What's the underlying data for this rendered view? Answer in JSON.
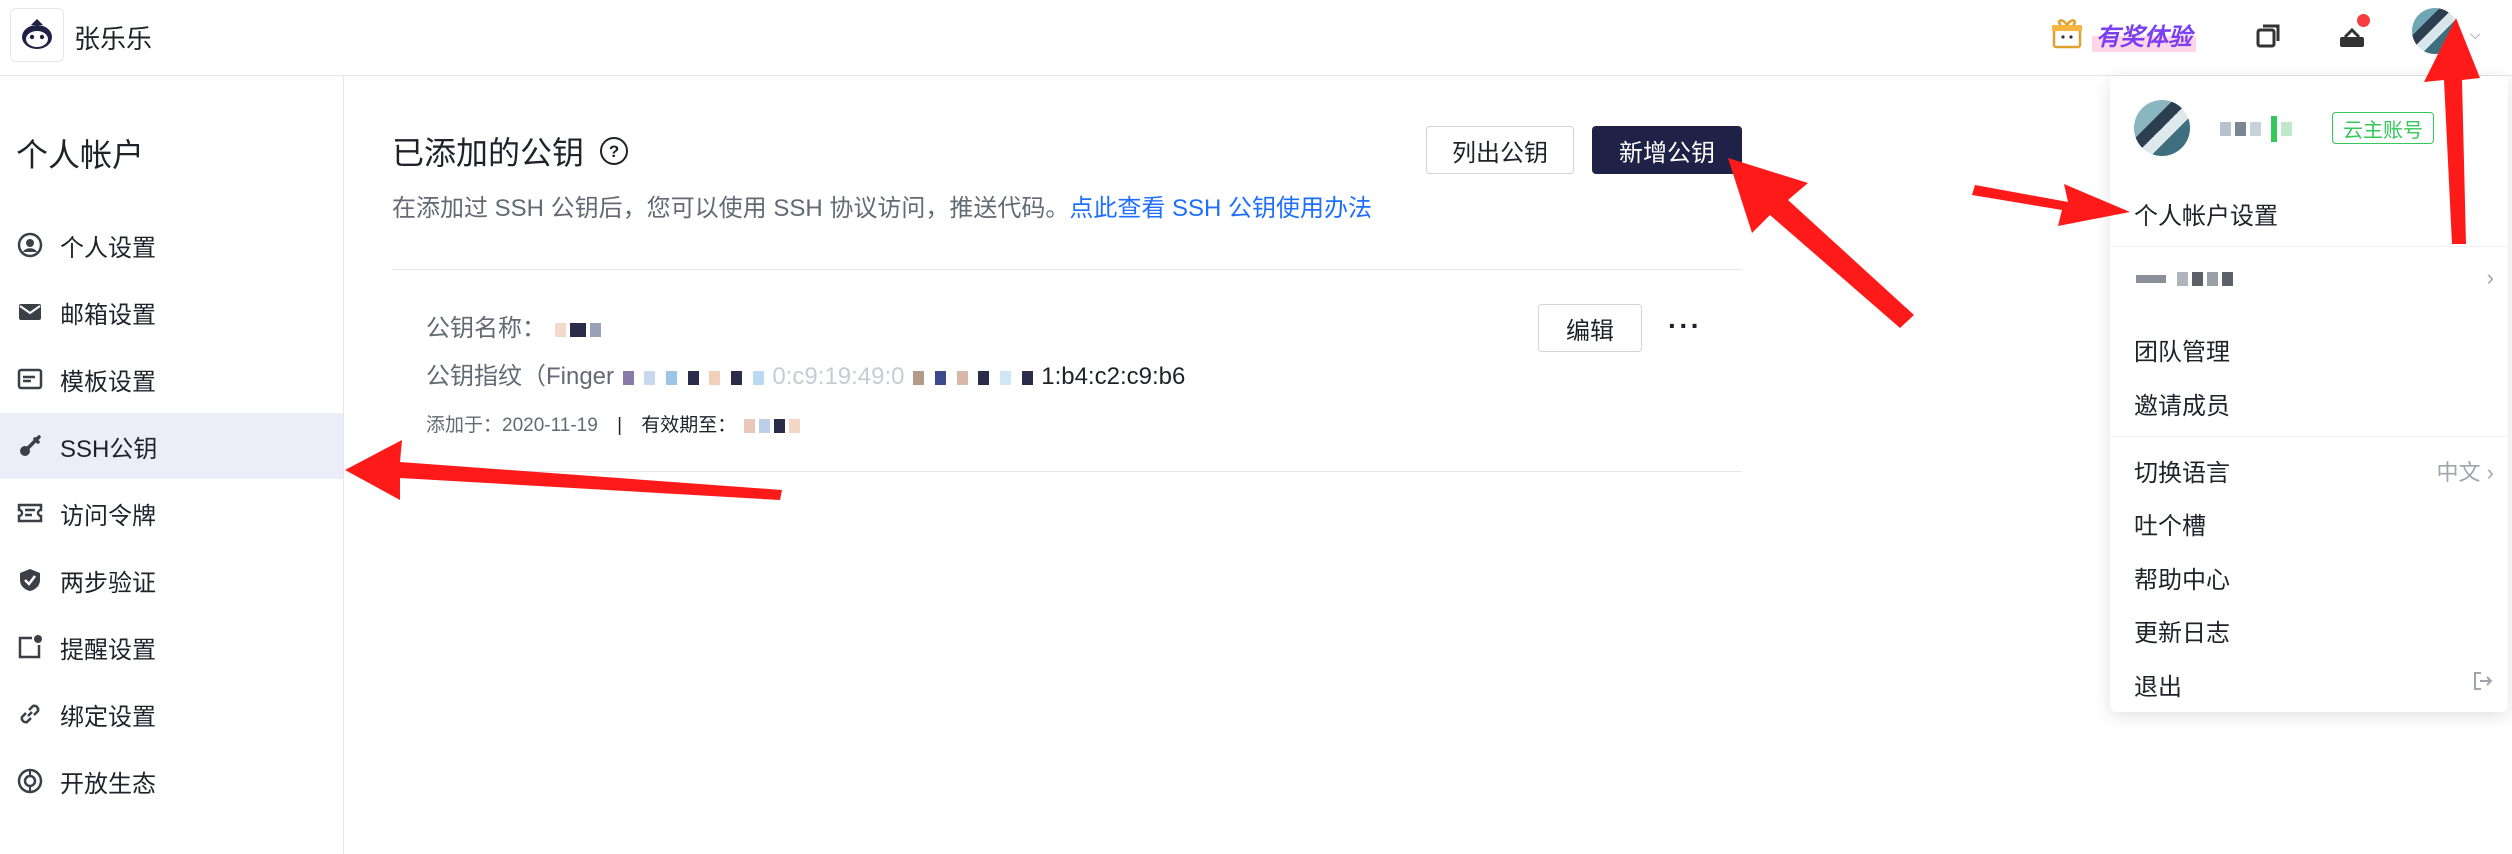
{
  "header": {
    "username": "张乐乐",
    "reward_label": "有奖体验"
  },
  "sidebar": {
    "title": "个人帐户",
    "items": [
      {
        "label": "个人设置",
        "icon": "user-circle-icon"
      },
      {
        "label": "邮箱设置",
        "icon": "mail-icon"
      },
      {
        "label": "模板设置",
        "icon": "template-icon"
      },
      {
        "label": "SSH公钥",
        "icon": "key-icon"
      },
      {
        "label": "访问令牌",
        "icon": "ticket-icon"
      },
      {
        "label": "两步验证",
        "icon": "shield-check-icon"
      },
      {
        "label": "提醒设置",
        "icon": "bell-square-icon"
      },
      {
        "label": "绑定设置",
        "icon": "link-icon"
      },
      {
        "label": "开放生态",
        "icon": "globe-icon"
      }
    ],
    "active_index": 3
  },
  "main": {
    "title": "已添加的公钥",
    "description": "在添加过 SSH 公钥后，您可以使用 SSH 协议访问，推送代码。",
    "description_link": "点此查看 SSH 公钥使用办法",
    "list_button": "列出公钥",
    "add_button": "新增公钥",
    "key": {
      "name_label": "公钥名称：",
      "fingerprint_label": "公钥指纹（Finger",
      "fingerprint_visible": "0:c9:19:49:0",
      "fingerprint_tail": "1:b4:c2:c9:b6",
      "added_label": "添加于：",
      "added_date": "2020-11-19",
      "separator": "|",
      "expiry_label": "有效期至：",
      "edit_button": "编辑"
    }
  },
  "dropdown": {
    "badge": "云主账号",
    "items": [
      {
        "label": "个人帐户设置",
        "right": ""
      },
      {
        "label": "团队管理",
        "right": ""
      },
      {
        "label": "邀请成员",
        "right": ""
      },
      {
        "label": "切换语言",
        "right": "中文"
      },
      {
        "label": "吐个槽",
        "right": ""
      },
      {
        "label": "帮助中心",
        "right": ""
      },
      {
        "label": "更新日志",
        "right": ""
      },
      {
        "label": "退出",
        "right": ""
      }
    ]
  },
  "colors": {
    "primary_dark": "#1f2246",
    "link": "#1e6fff",
    "active_bg": "#ededfa",
    "badge_green": "#34c759",
    "arrow_red": "#ff1a1a",
    "notice_dot": "#f53f3f"
  }
}
